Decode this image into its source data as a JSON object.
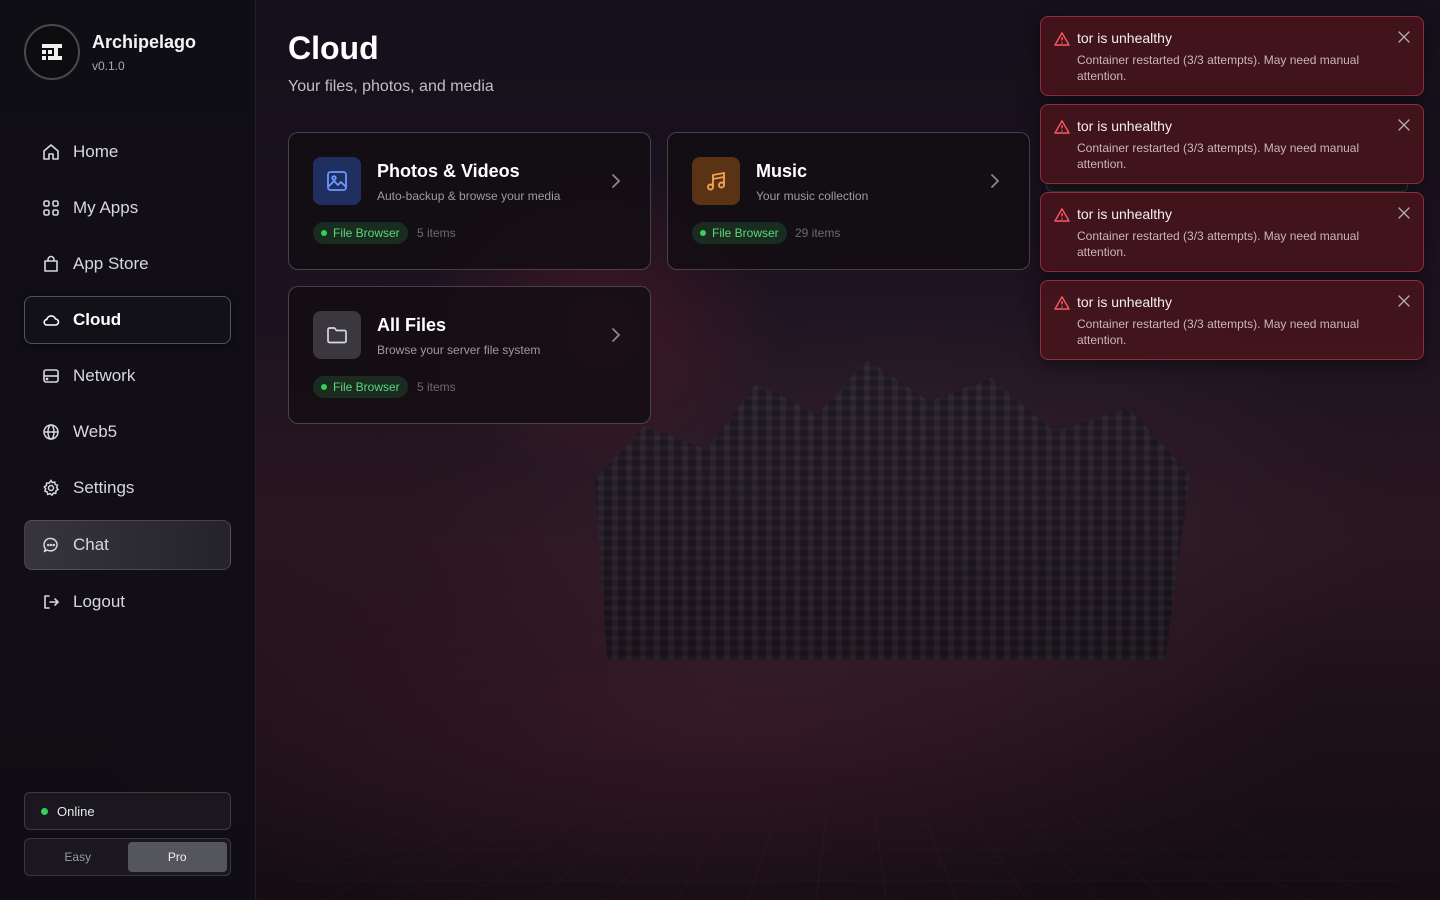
{
  "brand": {
    "name": "Archipelago",
    "version": "v0.1.0"
  },
  "nav": {
    "home": "Home",
    "my_apps": "My Apps",
    "app_store": "App Store",
    "cloud": "Cloud",
    "network": "Network",
    "web5": "Web5",
    "settings": "Settings",
    "chat": "Chat",
    "logout": "Logout"
  },
  "status": {
    "label": "Online",
    "color": "#34d058"
  },
  "mode": {
    "easy": "Easy",
    "pro": "Pro",
    "selected": "Pro"
  },
  "page": {
    "title": "Cloud",
    "subtitle": "Your files, photos, and media"
  },
  "cards": [
    {
      "title": "Photos & Videos",
      "desc": "Auto-backup & browse your media",
      "badge": "File Browser",
      "items": "5 items",
      "icon": "image-icon",
      "accent": "#4a7cf0"
    },
    {
      "title": "Music",
      "desc": "Your music collection",
      "badge": "File Browser",
      "items": "29 items",
      "icon": "music-note-icon",
      "accent": "#f0923a"
    },
    {
      "title": "All Files",
      "desc": "Browse your server file system",
      "badge": "File Browser",
      "items": "5 items",
      "icon": "folder-icon",
      "accent": "#d0d0d4"
    }
  ],
  "toasts": [
    {
      "title": "tor is unhealthy",
      "message": "Container restarted (3/3 attempts). May need manual attention."
    },
    {
      "title": "tor is unhealthy",
      "message": "Container restarted (3/3 attempts). May need manual attention."
    },
    {
      "title": "tor is unhealthy",
      "message": "Container restarted (3/3 attempts). May need manual attention."
    },
    {
      "title": "tor is unhealthy",
      "message": "Container restarted (3/3 attempts). May need manual attention."
    }
  ],
  "colors": {
    "badge_green": "#5ed67a",
    "toast_border": "#d24650"
  }
}
